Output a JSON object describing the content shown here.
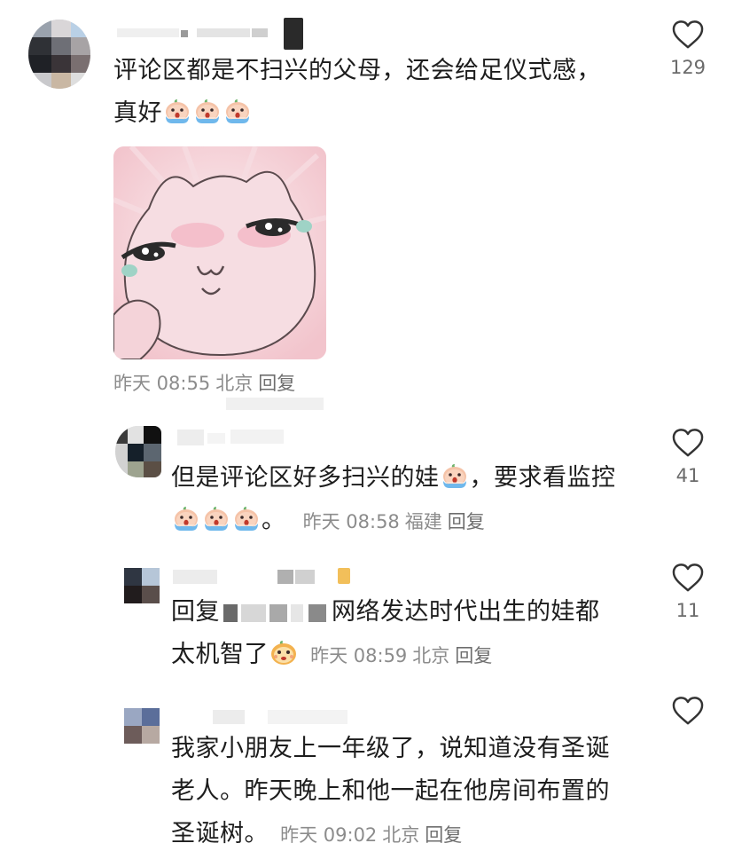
{
  "comments": [
    {
      "text": "评论区都是不扫兴的父母，还会给足仪式感，",
      "text2": "真好",
      "time": "昨天 08:55",
      "location": "北京",
      "reply_label": "回复",
      "likes": "129",
      "emoji_name": "crying-face-emoji"
    },
    {
      "text": "但是评论区好多扫兴的娃",
      "text2": "，要求看监控",
      "tail": "。",
      "time": "昨天 08:58",
      "location": "福建",
      "reply_label": "回复",
      "likes": "41"
    },
    {
      "prefix": "回复",
      "text": "网络发达时代出生的娃都",
      "text2": "太机智了",
      "time": "昨天 08:59",
      "location": "北京",
      "reply_label": "回复",
      "likes": "11"
    },
    {
      "text": "我家小朋友上一年级了，说知道没有圣诞",
      "text2": "老人。昨天晚上和他一起在他房间布置的",
      "text3": "圣诞树。",
      "time": "昨天 09:02",
      "location": "北京",
      "reply_label": "回复",
      "likes": ""
    }
  ],
  "icons": {
    "like": "heart-outline-icon",
    "sticker": "crying-cat-sticker"
  },
  "colors": {
    "text": "#1d1d1d",
    "meta": "#8c8c8c",
    "icon": "#333333"
  }
}
